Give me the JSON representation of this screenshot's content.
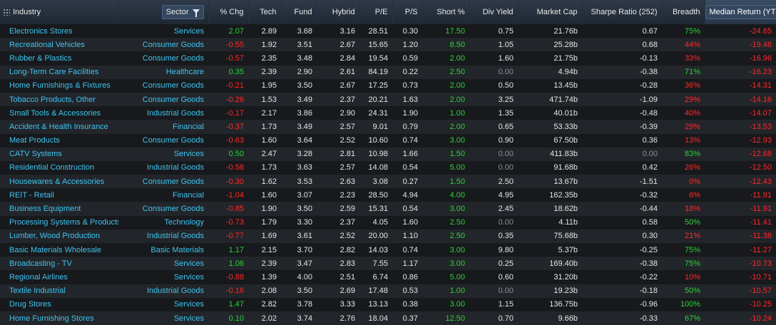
{
  "colors": {
    "positive": "#2ed23a",
    "negative": "#ff2a2a",
    "link": "#3fc4f0",
    "zero": "#8a8f96"
  },
  "columns": [
    {
      "key": "industry",
      "label": "Industry",
      "icon": "grip-icon"
    },
    {
      "key": "sector",
      "label": "Sector",
      "icon": "filter-icon"
    },
    {
      "key": "chg",
      "label": "% Chg"
    },
    {
      "key": "tech",
      "label": "Tech"
    },
    {
      "key": "fund",
      "label": "Fund"
    },
    {
      "key": "hybrid",
      "label": "Hybrid"
    },
    {
      "key": "pe",
      "label": "P/E"
    },
    {
      "key": "ps",
      "label": "P/S"
    },
    {
      "key": "short",
      "label": "Short %"
    },
    {
      "key": "div",
      "label": "Div Yield"
    },
    {
      "key": "mcap",
      "label": "Market Cap"
    },
    {
      "key": "sharpe",
      "label": "Sharpe Ratio (252)"
    },
    {
      "key": "breadth",
      "label": "Breadth"
    },
    {
      "key": "median",
      "label": "Median Return (YTD)",
      "icon": "filter-icon"
    }
  ],
  "rows": [
    [
      "Electronics Stores",
      "Services",
      "2.07",
      "2.89",
      "3.68",
      "3.16",
      "28.51",
      "0.30",
      "17.50",
      "0.75",
      "21.76b",
      "0.67",
      "75%",
      "-24.65"
    ],
    [
      "Recreational Vehicles",
      "Consumer Goods",
      "-0.55",
      "1.92",
      "3.51",
      "2.67",
      "15.65",
      "1.20",
      "8.50",
      "1.05",
      "25.28b",
      "0.68",
      "44%",
      "-19.48"
    ],
    [
      "Rubber & Plastics",
      "Consumer Goods",
      "-0.57",
      "2.35",
      "3.48",
      "2.84",
      "19.54",
      "0.59",
      "2.00",
      "1.60",
      "21.75b",
      "-0.13",
      "33%",
      "-16.96"
    ],
    [
      "Long-Term Care Facilities",
      "Healthcare",
      "0.35",
      "2.39",
      "2.90",
      "2.61",
      "84.19",
      "0.22",
      "2.50",
      "0.00",
      "4.94b",
      "-0.38",
      "71%",
      "-16.23"
    ],
    [
      "Home Furnishings & Fixtures",
      "Consumer Goods",
      "-0.21",
      "1.95",
      "3.50",
      "2.67",
      "17.25",
      "0.73",
      "2.00",
      "0.50",
      "13.45b",
      "-0.28",
      "36%",
      "-14.31"
    ],
    [
      "Tobacco Products, Other",
      "Consumer Goods",
      "-0.26",
      "1.53",
      "3.49",
      "2.37",
      "20.21",
      "1.63",
      "2.00",
      "3.25",
      "471.74b",
      "-1.09",
      "29%",
      "-14.16"
    ],
    [
      "Small Tools & Accessories",
      "Industrial Goods",
      "-0.17",
      "2.17",
      "3.86",
      "2.90",
      "24.31",
      "1.90",
      "1.00",
      "1.35",
      "40.01b",
      "-0.48",
      "40%",
      "-14.07"
    ],
    [
      "Accident & Health Insurance",
      "Financial",
      "-0.37",
      "1.73",
      "3.49",
      "2.57",
      "9.01",
      "0.79",
      "2.00",
      "0.65",
      "53.33b",
      "-0.39",
      "29%",
      "-13.53"
    ],
    [
      "Meat Products",
      "Consumer Goods",
      "-0.63",
      "1.60",
      "3.64",
      "2.52",
      "10.60",
      "0.74",
      "3.00",
      "0.90",
      "67.50b",
      "0.36",
      "13%",
      "-12.93"
    ],
    [
      "CATV Systems",
      "Services",
      "0.50",
      "2.47",
      "3.28",
      "2.81",
      "10.98",
      "1.66",
      "1.50",
      "0.00",
      "411.83b",
      "0.00",
      "83%",
      "-12.68"
    ],
    [
      "Residential Construction",
      "Industrial Goods",
      "-0.58",
      "1.73",
      "3.63",
      "2.57",
      "14.08",
      "0.54",
      "5.00",
      "0.00",
      "91.68b",
      "0.42",
      "26%",
      "-12.50"
    ],
    [
      "Housewares & Accessories",
      "Consumer Goods",
      "-0.30",
      "1.62",
      "3.53",
      "2.63",
      "3.08",
      "0.27",
      "1.50",
      "2.50",
      "13.67b",
      "-1.51",
      "0%",
      "-12.43"
    ],
    [
      "REIT - Retail",
      "Financial",
      "-1.04",
      "1.60",
      "3.07",
      "2.23",
      "28.50",
      "4.94",
      "4.00",
      "4.95",
      "162.35b",
      "-0.32",
      "6%",
      "-11.91"
    ],
    [
      "Business Equipment",
      "Consumer Goods",
      "-0.85",
      "1.90",
      "3.50",
      "2.59",
      "15.31",
      "0.54",
      "3.00",
      "2.45",
      "18.62b",
      "-0.44",
      "18%",
      "-11.91"
    ],
    [
      "Processing Systems & Products",
      "Technology",
      "-0.73",
      "1.79",
      "3.30",
      "2.37",
      "4.05",
      "1.60",
      "2.50",
      "0.00",
      "4.11b",
      "0.58",
      "50%",
      "-11.41"
    ],
    [
      "Lumber, Wood Production",
      "Industrial Goods",
      "-0.77",
      "1.69",
      "3.61",
      "2.52",
      "20.00",
      "1.10",
      "2.50",
      "0.35",
      "75.68b",
      "0.30",
      "21%",
      "-11.38"
    ],
    [
      "Basic Materials Wholesale",
      "Basic Materials",
      "1.17",
      "2.15",
      "3.70",
      "2.82",
      "14.03",
      "0.74",
      "3.00",
      "9.80",
      "5.37b",
      "-0.25",
      "75%",
      "-11.27"
    ],
    [
      "Broadcasting - TV",
      "Services",
      "1.06",
      "2.39",
      "3.47",
      "2.83",
      "7.55",
      "1.17",
      "3.00",
      "0.25",
      "169.40b",
      "-0.38",
      "75%",
      "-10.73"
    ],
    [
      "Regional Airlines",
      "Services",
      "-0.88",
      "1.39",
      "4.00",
      "2.51",
      "6.74",
      "0.86",
      "5.00",
      "0.60",
      "31.20b",
      "-0.22",
      "10%",
      "-10.71"
    ],
    [
      "Textile Industrial",
      "Industrial Goods",
      "-0.16",
      "2.08",
      "3.50",
      "2.69",
      "17.48",
      "0.53",
      "1.00",
      "0.00",
      "19.23b",
      "-0.18",
      "50%",
      "-10.57"
    ],
    [
      "Drug Stores",
      "Services",
      "1.47",
      "2.82",
      "3.78",
      "3.33",
      "13.13",
      "0.38",
      "3.00",
      "1.15",
      "136.75b",
      "-0.96",
      "100%",
      "-10.25"
    ],
    [
      "Home Furnishing Stores",
      "Services",
      "0.10",
      "2.02",
      "3.74",
      "2.76",
      "18.04",
      "0.37",
      "12.50",
      "0.70",
      "9.66b",
      "-0.33",
      "67%",
      "-10.24"
    ]
  ]
}
